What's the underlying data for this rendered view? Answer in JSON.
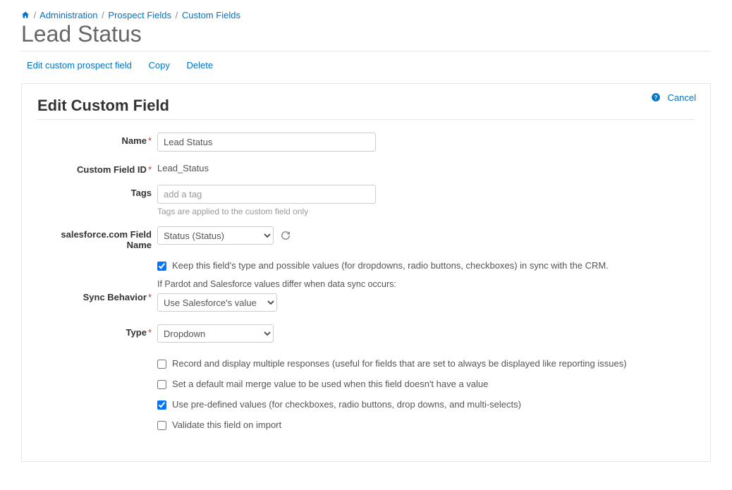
{
  "breadcrumb": {
    "admin": "Administration",
    "prospect_fields": "Prospect Fields",
    "custom_fields": "Custom Fields"
  },
  "page_title": "Lead Status",
  "actions": {
    "edit": "Edit custom prospect field",
    "copy": "Copy",
    "delete": "Delete"
  },
  "panel": {
    "title": "Edit Custom Field",
    "cancel": "Cancel"
  },
  "form": {
    "name_label": "Name",
    "name_value": "Lead Status",
    "custom_id_label": "Custom Field ID",
    "custom_id_value": "Lead_Status",
    "tags_label": "Tags",
    "tags_placeholder": "add a tag",
    "tags_help": "Tags are applied to the custom field only",
    "sf_field_label": "salesforce.com Field Name",
    "sf_field_value": "Status (Status)",
    "sync_checkbox": "Keep this field's type and possible values (for dropdowns, radio buttons, checkboxes) in sync with the CRM.",
    "sync_behavior_label": "Sync Behavior",
    "sync_behavior_note": "If Pardot and Salesforce values differ when data sync occurs:",
    "sync_behavior_value": "Use Salesforce's value",
    "type_label": "Type",
    "type_value": "Dropdown",
    "opt_multi": "Record and display multiple responses (useful for fields that are set to always be displayed like reporting issues)",
    "opt_default_merge": "Set a default mail merge value to be used when this field doesn't have a value",
    "opt_predefined": "Use pre-defined values (for checkboxes, radio buttons, drop downs, and multi-selects)",
    "opt_validate": "Validate this field on import"
  }
}
